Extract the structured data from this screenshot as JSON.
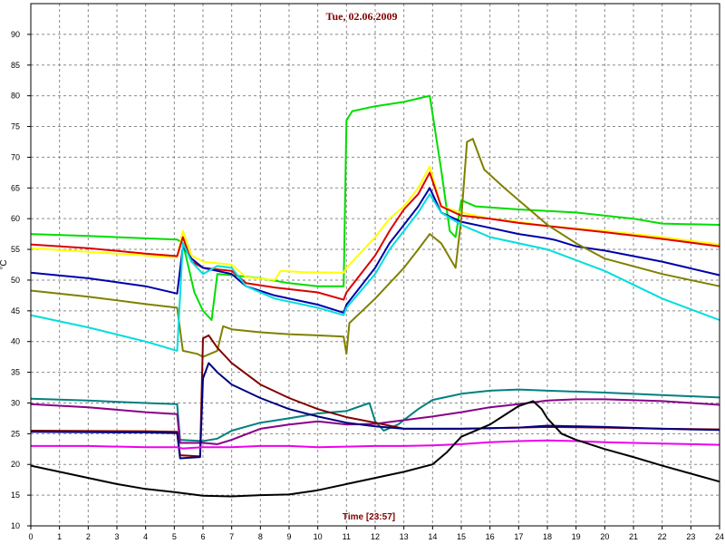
{
  "chart_data": {
    "type": "line",
    "title": "Tue, 02.06.2009",
    "xlabel": "Time [23:57]",
    "ylabel": "°C",
    "xlim": [
      0,
      24
    ],
    "ylim": [
      10,
      95
    ],
    "x_ticks": [
      0,
      1,
      2,
      3,
      4,
      5,
      6,
      7,
      8,
      9,
      10,
      11,
      12,
      13,
      14,
      15,
      16,
      17,
      18,
      19,
      20,
      21,
      22,
      23,
      24
    ],
    "y_ticks": [
      10,
      15,
      20,
      25,
      30,
      35,
      40,
      45,
      50,
      55,
      60,
      65,
      70,
      75,
      80,
      85,
      90
    ],
    "grid": true,
    "series": [
      {
        "color": "#00dd00",
        "points": [
          [
            0,
            57.5
          ],
          [
            2,
            57.2
          ],
          [
            4,
            56.8
          ],
          [
            5.1,
            56.6
          ],
          [
            5.3,
            56
          ],
          [
            5.5,
            52
          ],
          [
            5.7,
            48
          ],
          [
            6.0,
            45
          ],
          [
            6.3,
            43.5
          ],
          [
            6.5,
            51
          ],
          [
            7,
            50.8
          ],
          [
            8,
            50.3
          ],
          [
            9,
            49.5
          ],
          [
            10,
            49
          ],
          [
            10.9,
            49
          ],
          [
            11.0,
            76
          ],
          [
            11.2,
            77.5
          ],
          [
            12,
            78.3
          ],
          [
            13,
            79
          ],
          [
            13.9,
            80
          ],
          [
            14.3,
            68
          ],
          [
            14.6,
            58
          ],
          [
            14.8,
            57
          ],
          [
            15.0,
            63
          ],
          [
            15.5,
            62
          ],
          [
            17,
            61.5
          ],
          [
            19,
            61
          ],
          [
            21,
            60
          ],
          [
            22,
            59.2
          ],
          [
            24,
            59
          ]
        ]
      },
      {
        "color": "#ffff00",
        "points": [
          [
            0,
            55.2
          ],
          [
            2,
            54.6
          ],
          [
            4,
            54
          ],
          [
            5.1,
            53.7
          ],
          [
            5.3,
            58
          ],
          [
            5.6,
            54
          ],
          [
            6,
            53
          ],
          [
            7,
            52.5
          ],
          [
            7.5,
            50.5
          ],
          [
            8.5,
            50
          ],
          [
            8.7,
            51.5
          ],
          [
            9.5,
            51.3
          ],
          [
            10.9,
            51.2
          ],
          [
            11,
            52
          ],
          [
            12,
            57
          ],
          [
            12.5,
            60
          ],
          [
            13,
            62
          ],
          [
            13.5,
            65
          ],
          [
            13.9,
            68.5
          ],
          [
            14.3,
            62
          ],
          [
            15,
            61
          ],
          [
            16,
            60
          ],
          [
            17,
            59.5
          ],
          [
            18,
            58.8
          ],
          [
            20,
            58
          ],
          [
            22,
            57
          ],
          [
            24,
            55.8
          ]
        ]
      },
      {
        "color": "#dd0000",
        "points": [
          [
            0,
            55.8
          ],
          [
            2,
            55.2
          ],
          [
            4,
            54.3
          ],
          [
            5.1,
            53.9
          ],
          [
            5.3,
            57
          ],
          [
            5.6,
            53
          ],
          [
            6,
            52
          ],
          [
            7,
            51.5
          ],
          [
            7.5,
            49.5
          ],
          [
            8.5,
            48.8
          ],
          [
            10,
            48
          ],
          [
            10.9,
            46.8
          ],
          [
            11,
            48
          ],
          [
            12,
            54
          ],
          [
            12.5,
            58
          ],
          [
            13,
            61.5
          ],
          [
            13.5,
            64
          ],
          [
            13.9,
            67.5
          ],
          [
            14.3,
            62
          ],
          [
            15,
            60.5
          ],
          [
            16,
            60
          ],
          [
            17,
            59.3
          ],
          [
            18,
            58.8
          ],
          [
            20,
            57.8
          ],
          [
            22,
            56.7
          ],
          [
            24,
            55.5
          ]
        ]
      },
      {
        "color": "#0000aa",
        "points": [
          [
            0,
            51.2
          ],
          [
            2,
            50.3
          ],
          [
            4,
            49
          ],
          [
            5.1,
            47.8
          ],
          [
            5.3,
            55.5
          ],
          [
            5.6,
            53.5
          ],
          [
            6,
            52
          ],
          [
            6.5,
            51.5
          ],
          [
            7,
            51
          ],
          [
            7.5,
            49
          ],
          [
            8.5,
            47.5
          ],
          [
            10,
            46
          ],
          [
            10.9,
            44.7
          ],
          [
            11,
            46
          ],
          [
            12,
            52
          ],
          [
            12.5,
            56
          ],
          [
            13,
            59
          ],
          [
            13.5,
            62
          ],
          [
            13.9,
            65
          ],
          [
            14.3,
            61
          ],
          [
            15,
            59.5
          ],
          [
            16,
            58.5
          ],
          [
            17,
            57.5
          ],
          [
            18,
            56.8
          ],
          [
            18.3,
            56.5
          ],
          [
            19,
            55.5
          ],
          [
            20,
            54.8
          ],
          [
            22,
            53
          ],
          [
            24,
            50.8
          ]
        ]
      },
      {
        "color": "#808000",
        "points": [
          [
            0,
            48.3
          ],
          [
            2,
            47.3
          ],
          [
            4,
            46.1
          ],
          [
            5.1,
            45.5
          ],
          [
            5.3,
            38.5
          ],
          [
            5.8,
            38
          ],
          [
            6,
            37.5
          ],
          [
            6.5,
            38.5
          ],
          [
            6.7,
            42.5
          ],
          [
            7,
            42
          ],
          [
            8,
            41.5
          ],
          [
            9,
            41.2
          ],
          [
            10,
            41
          ],
          [
            10.9,
            40.8
          ],
          [
            11,
            38
          ],
          [
            11.1,
            43
          ],
          [
            12,
            47
          ],
          [
            13,
            52
          ],
          [
            13.5,
            55
          ],
          [
            13.9,
            57.5
          ],
          [
            14.3,
            56
          ],
          [
            14.8,
            52
          ],
          [
            15.0,
            60
          ],
          [
            15.2,
            72.5
          ],
          [
            15.4,
            73
          ],
          [
            15.8,
            68
          ],
          [
            16.5,
            65
          ],
          [
            17.5,
            61
          ],
          [
            18,
            59
          ],
          [
            19,
            56
          ],
          [
            20,
            53.5
          ],
          [
            22,
            51
          ],
          [
            24,
            49
          ]
        ]
      },
      {
        "color": "#00dddd",
        "points": [
          [
            0,
            44.3
          ],
          [
            2,
            42.3
          ],
          [
            4,
            40
          ],
          [
            5.1,
            38.5
          ],
          [
            5.3,
            56
          ],
          [
            5.6,
            53
          ],
          [
            6,
            51
          ],
          [
            6.5,
            52.3
          ],
          [
            7,
            52
          ],
          [
            7.5,
            49
          ],
          [
            8.5,
            47
          ],
          [
            10,
            45.5
          ],
          [
            10.9,
            44.3
          ],
          [
            11,
            45.5
          ],
          [
            12,
            51
          ],
          [
            12.5,
            55
          ],
          [
            13,
            58
          ],
          [
            13.5,
            61
          ],
          [
            13.9,
            64
          ],
          [
            14.3,
            61
          ],
          [
            15,
            59
          ],
          [
            16,
            57
          ],
          [
            18,
            55
          ],
          [
            20,
            51.5
          ],
          [
            22,
            47
          ],
          [
            24,
            43.5
          ]
        ]
      },
      {
        "color": "#008080",
        "points": [
          [
            0,
            30.7
          ],
          [
            2,
            30.4
          ],
          [
            4,
            30
          ],
          [
            5.1,
            29.8
          ],
          [
            5.2,
            24
          ],
          [
            6,
            23.8
          ],
          [
            6.5,
            24.2
          ],
          [
            7,
            25.5
          ],
          [
            8,
            26.8
          ],
          [
            9,
            27.5
          ],
          [
            10,
            28.3
          ],
          [
            11,
            28.7
          ],
          [
            11.8,
            30
          ],
          [
            12,
            27
          ],
          [
            12.3,
            25.5
          ],
          [
            12.8,
            26.5
          ],
          [
            13.5,
            29
          ],
          [
            14,
            30.5
          ],
          [
            15,
            31.5
          ],
          [
            16,
            32
          ],
          [
            17,
            32.2
          ],
          [
            18,
            32
          ],
          [
            20,
            31.7
          ],
          [
            22,
            31.3
          ],
          [
            24,
            30.9
          ]
        ]
      },
      {
        "color": "#880088",
        "points": [
          [
            0,
            29.8
          ],
          [
            2,
            29.3
          ],
          [
            4,
            28.5
          ],
          [
            5.1,
            28.2
          ],
          [
            5.2,
            23.5
          ],
          [
            6.0,
            23.5
          ],
          [
            6.5,
            23.3
          ],
          [
            7,
            24
          ],
          [
            8,
            25.8
          ],
          [
            9,
            26.5
          ],
          [
            10,
            27
          ],
          [
            11,
            26.5
          ],
          [
            12,
            26.6
          ],
          [
            13,
            27.2
          ],
          [
            14,
            27.8
          ],
          [
            15,
            28.5
          ],
          [
            16,
            29.3
          ],
          [
            17,
            29.8
          ],
          [
            18,
            30.4
          ],
          [
            19,
            30.6
          ],
          [
            20,
            30.6
          ],
          [
            22,
            30.3
          ],
          [
            24,
            29.7
          ]
        ]
      },
      {
        "color": "#800000",
        "points": [
          [
            0,
            25.5
          ],
          [
            4,
            25.4
          ],
          [
            5.1,
            25.3
          ],
          [
            5.2,
            21.5
          ],
          [
            5.9,
            21.3
          ],
          [
            6.0,
            40.5
          ],
          [
            6.2,
            41
          ],
          [
            6.5,
            39
          ],
          [
            7,
            36.5
          ],
          [
            8,
            33
          ],
          [
            9,
            30.8
          ],
          [
            10,
            29
          ],
          [
            11,
            27.7
          ],
          [
            12,
            26.8
          ],
          [
            12.5,
            26.3
          ],
          [
            13,
            25.8
          ],
          [
            15,
            25.8
          ],
          [
            17,
            26
          ],
          [
            18,
            26.1
          ],
          [
            20,
            26
          ],
          [
            22,
            25.8
          ],
          [
            24,
            25.7
          ]
        ]
      },
      {
        "color": "#000080",
        "points": [
          [
            0,
            25.3
          ],
          [
            4,
            25.2
          ],
          [
            5.1,
            25.1
          ],
          [
            5.2,
            21
          ],
          [
            5.9,
            21.2
          ],
          [
            6.0,
            34
          ],
          [
            6.2,
            36.5
          ],
          [
            6.5,
            35
          ],
          [
            7,
            33
          ],
          [
            8,
            30.8
          ],
          [
            9,
            29
          ],
          [
            10,
            27.8
          ],
          [
            11,
            26.8
          ],
          [
            12,
            26.2
          ],
          [
            13,
            25.8
          ],
          [
            15,
            25.8
          ],
          [
            17,
            26
          ],
          [
            18,
            26.3
          ],
          [
            20,
            26.1
          ],
          [
            22,
            25.8
          ],
          [
            24,
            25.6
          ]
        ]
      },
      {
        "color": "#ee00ee",
        "points": [
          [
            0,
            23
          ],
          [
            2,
            23
          ],
          [
            4,
            22.8
          ],
          [
            5.1,
            22.8
          ],
          [
            5.3,
            22.6
          ],
          [
            6,
            22.8
          ],
          [
            7,
            22.8
          ],
          [
            8,
            23
          ],
          [
            9,
            23
          ],
          [
            10,
            22.8
          ],
          [
            11,
            22.9
          ],
          [
            12,
            23
          ],
          [
            13,
            23
          ],
          [
            14,
            23.1
          ],
          [
            15,
            23.3
          ],
          [
            16,
            23.6
          ],
          [
            17,
            23.8
          ],
          [
            18,
            23.9
          ],
          [
            19,
            23.8
          ],
          [
            20,
            23.6
          ],
          [
            22,
            23.4
          ],
          [
            24,
            23.2
          ]
        ]
      },
      {
        "color": "#000000",
        "points": [
          [
            0,
            19.8
          ],
          [
            1,
            18.8
          ],
          [
            2,
            17.8
          ],
          [
            3,
            16.8
          ],
          [
            4,
            16
          ],
          [
            5,
            15.5
          ],
          [
            6,
            14.9
          ],
          [
            7,
            14.8
          ],
          [
            8,
            15
          ],
          [
            9,
            15.1
          ],
          [
            10,
            15.8
          ],
          [
            11,
            16.8
          ],
          [
            12,
            17.8
          ],
          [
            13,
            18.8
          ],
          [
            14,
            20
          ],
          [
            14.5,
            22
          ],
          [
            15,
            24.5
          ],
          [
            16,
            26.5
          ],
          [
            16.5,
            28
          ],
          [
            17,
            29.5
          ],
          [
            17.5,
            30.3
          ],
          [
            17.8,
            29
          ],
          [
            18,
            27.5
          ],
          [
            18.5,
            25
          ],
          [
            19,
            24
          ],
          [
            20,
            22.5
          ],
          [
            21,
            21.2
          ],
          [
            22,
            19.8
          ],
          [
            23,
            18.5
          ],
          [
            24,
            17.2
          ]
        ]
      }
    ]
  }
}
